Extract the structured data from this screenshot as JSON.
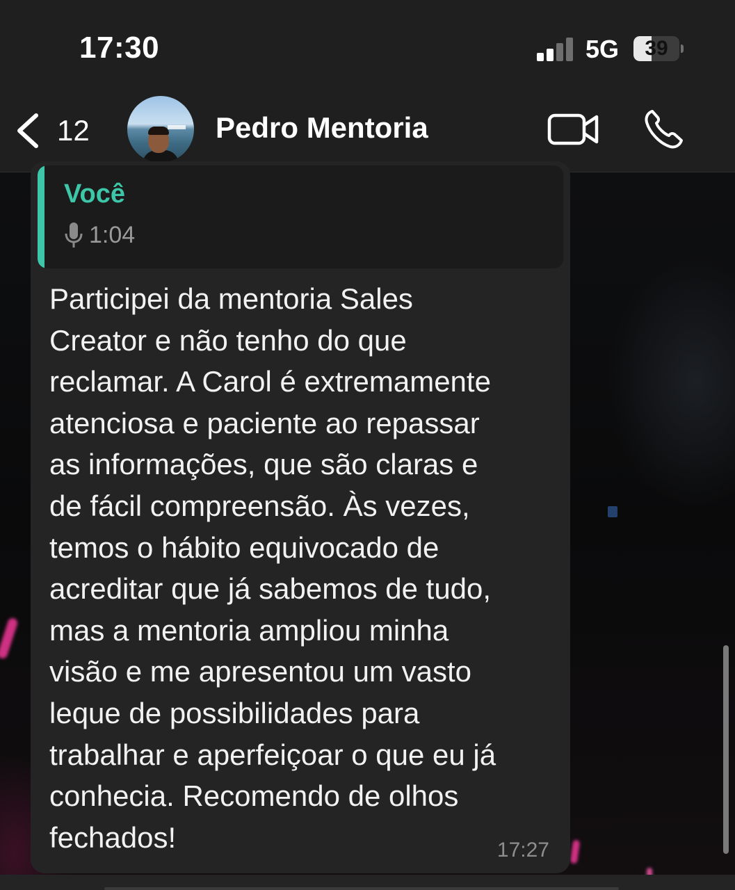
{
  "status_bar": {
    "time": "17:30",
    "network": "5G",
    "signal_bars_active": 2,
    "signal_bars_total": 4,
    "battery_level": "39",
    "battery_fraction": 0.39
  },
  "header": {
    "back_count": "12",
    "contact_name": "Pedro Mentoria",
    "icons": [
      "chevron-left-icon",
      "video-camera-icon",
      "phone-icon"
    ]
  },
  "message": {
    "quoted": {
      "author": "Você",
      "audio_duration": "1:04",
      "icon": "microphone-icon"
    },
    "text": "Participei da mentoria Sales\nCreator e não tenho do que\nreclamar. A Carol é extremamente\natenciosa e paciente ao repassar\nas informações, que são claras e\nde fácil compreensão. Às vezes,\ntemos o hábito equivocado de\nacreditar que já sabemos de tudo,\nmas a mentoria ampliou minha\nvisão e me apresentou um vasto\nleque de possibilidades para\ntrabalhar e aperfeiçoar o que eu já\nconhecia. Recomendo de olhos\nfechados!",
    "time": "17:27"
  },
  "colors": {
    "accent": "#3ec6a8",
    "bubble": "#242424",
    "header": "#1f1f1f"
  }
}
